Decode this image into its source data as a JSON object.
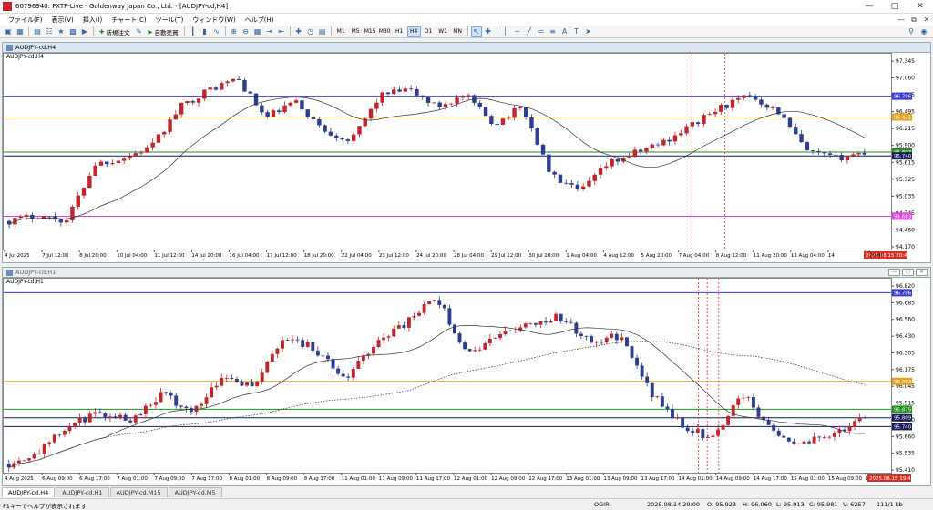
{
  "window": {
    "title": "60796940: FXTF-Live - Goldenway Japan Co., Ltd. - [AUDJPY-cd,H4]"
  },
  "menu": [
    "ファイル(F)",
    "表示(V)",
    "挿入(I)",
    "チャート(C)",
    "ツール(T)",
    "ウィンドウ(W)",
    "ヘルプ(H)"
  ],
  "toolbar": {
    "new_order": "新規注文",
    "auto_trade": "自動売買",
    "timeframes": [
      "M1",
      "M5",
      "M15",
      "M30",
      "H1",
      "H4",
      "D1",
      "W1",
      "MN"
    ],
    "active_timeframe": "H4"
  },
  "top_chart": {
    "window_title": "AUDJPY-cd,H4",
    "symbol_label": "AUDJPY-cd,H4",
    "y_ticks": [
      "97.345",
      "97.060",
      "96.785",
      "96.495",
      "96.215",
      "95.900",
      "95.615",
      "95.325",
      "95.035",
      "94.745",
      "94.460",
      "94.170"
    ],
    "x_ticks": [
      "4 Jul 2025",
      "7 Jul 12:00",
      "8 Jul 20:00",
      "10 Jul 04:00",
      "11 Jul 12:00",
      "14 Jul 20:00",
      "16 Jul 04:00",
      "17 Jul 12:00",
      "18 Jul 20:00",
      "22 Jul 04:00",
      "23 Jul 12:00",
      "24 Jul 20:00",
      "28 Jul 04:00",
      "29 Jul 12:00",
      "30 Jul 20:00",
      "1 Aug 04:00",
      "4 Aug 12:00",
      "5 Aug 20:00",
      "7 Aug 04:00",
      "8 Aug 12:00",
      "11 Aug 20:00",
      "13 Aug 04:00",
      "14",
      "2025.08.15 20:45",
      "20:00"
    ],
    "hline_labels": [
      {
        "text": "96.786",
        "color": "#3a3ad8"
      },
      {
        "text": "96.421",
        "color": "#e8a317"
      },
      {
        "text": "95.807",
        "color": "#1f8f1f"
      },
      {
        "text": "95.740",
        "color": "#1a1a5a"
      },
      {
        "text": "94.683",
        "color": "#e040e0"
      }
    ],
    "time_marker": "2025.08.15 20:45"
  },
  "bottom_chart": {
    "window_title": "AUDJPY-cd,H1",
    "symbol_label": "AUDJPY-cd,H1",
    "y_ticks": [
      "96.820",
      "96.685",
      "96.560",
      "96.430",
      "96.305",
      "96.175",
      "96.045",
      "95.915",
      "95.790",
      "95.660",
      "95.535",
      "95.410"
    ],
    "x_ticks": [
      "4 Aug 2025",
      "6 Aug 09:00",
      "6 Aug 17:00",
      "7 Aug 01:00",
      "7 Aug 09:00",
      "7 Aug 17:00",
      "8 Aug 01:00",
      "8 Aug 09:00",
      "8 Aug 17:00",
      "11 Aug 01:00",
      "11 Aug 09:00",
      "11 Aug 17:00",
      "12 Aug 01:00",
      "12 Aug 09:00",
      "12 Aug 17:00",
      "13 Aug 01:00",
      "13 Aug 09:00",
      "13 Aug 17:00",
      "14 Aug 01:00",
      "14 Aug 09:00",
      "14 Aug 17:00",
      "15 Aug 01:00",
      "15 Aug 09:00",
      "15 A",
      "2025.08.15 19:45"
    ],
    "hline_labels": [
      {
        "text": "96.786",
        "color": "#3a3ad8"
      },
      {
        "text": "96.093",
        "color": "#e8a317"
      },
      {
        "text": "95.875",
        "color": "#1f8f1f"
      },
      {
        "text": "95.809",
        "color": "#1a1a5a"
      },
      {
        "text": "95.740",
        "color": "#1a1a5a"
      }
    ],
    "time_marker": "2025.08.15 19:45"
  },
  "tabs": [
    "AUDJPY-cd,H4",
    "AUDJPY-cd,H1",
    "AUDJPY-cd,M15",
    "AUDJPY-cd,M5"
  ],
  "active_tab": "AUDJPY-cd,H4",
  "status": {
    "help": "F1キーでヘルプが表示されます",
    "profile": "OGIR",
    "datetime": "2025.08.14 20:00",
    "open": "O: 95.923",
    "high": "H: 96.060",
    "low": "L: 95.913",
    "close": "C: 95.981",
    "volume": "V: 6257",
    "traffic": "111/1 kb"
  }
}
